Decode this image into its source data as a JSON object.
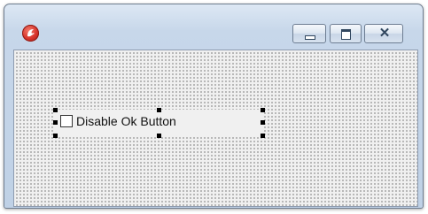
{
  "window": {
    "title_icon": "app-logo-icon",
    "controls": {
      "minimize_icon": "minimize-icon",
      "maximize_icon": "maximize-icon",
      "close_icon": "close-icon",
      "close_glyph": "✕"
    }
  },
  "form": {
    "checkbox": {
      "label": "Disable Ok Button",
      "checked": false
    }
  },
  "colors": {
    "title_icon": "#d7322a",
    "frame": "#c7d7ea"
  }
}
